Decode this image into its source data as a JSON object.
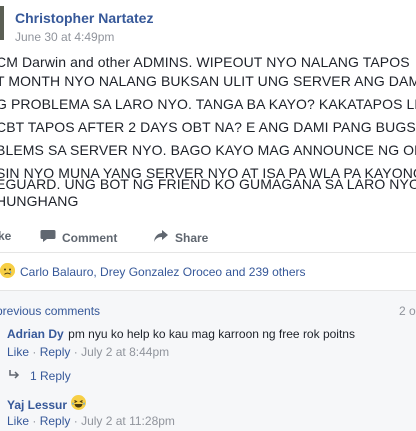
{
  "post": {
    "author": "Christopher Nartatez",
    "timestamp": "June 30 at 4:49pm",
    "lines": [
      "CM Darwin and other ADMINS. WIPEOUT NYO NALANG TAPOS",
      "T MONTH NYO NALANG BUKSAN ULIT UNG SERVER ANG DAMI",
      "G PROBLEMA SA LARO NYO. TANGA BA KAYO? KAKATAPOS LN",
      "CBT TAPOS AFTER 2 DAYS OBT NA? E ANG DAMI PANG BUGS A",
      "BLEMS SA SERVER NYO. BAGO KAYO MAG ANNOUNCE NG OB",
      "SIN NYO MUNA YANG SERVER NYO AT ISA PA WLA PA KAYONG",
      "EGUARD. UNG BOT NG FRIEND KO GUMAGANA SA LARO NYO",
      "HUNGHANG"
    ]
  },
  "actions": {
    "like": "ke",
    "comment": "Comment",
    "share": "Share"
  },
  "reactions": {
    "text": "Carlo Balauro, Drey Gonzalez Oroceo and 239 others"
  },
  "comments": {
    "previous_link": "previous comments",
    "count": "2 o",
    "items": [
      {
        "author": "Adrian Dy",
        "text": "pm nyu ko help ko kau mag karroon ng free rok poitns",
        "like": "Like",
        "reply": "Reply",
        "time": "July 2 at 8:44pm"
      },
      {
        "author": "Yaj Lessur",
        "text": "",
        "like": "Like",
        "reply": "Reply",
        "time": "July 2 at 11:28pm"
      }
    ],
    "replies_link": "1 Reply"
  },
  "icons": {
    "comment": "comment-bubble-icon",
    "share": "share-arrow-icon",
    "reaction": "sad-face-icon",
    "emoji": "laughing-face-icon",
    "reply": "reply-arrow-icon"
  },
  "colors": {
    "link": "#365899",
    "text": "#1d2129",
    "muted": "#90949c",
    "comments_bg": "#f6f7f9"
  }
}
